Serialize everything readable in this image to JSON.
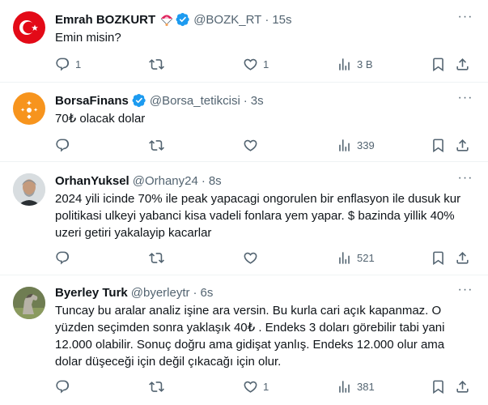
{
  "tweets": [
    {
      "name": "Emrah BOZKURT",
      "handle": "@BOZK_RT",
      "time": "15s",
      "text": "Emin misin?",
      "replies": "1",
      "retweets": "",
      "likes": "1",
      "views": "3 B",
      "icons": {
        "avatar": "turkish-flag-avatar",
        "emoji": "parachute-icon",
        "badge": "verified-icon"
      }
    },
    {
      "name": "BorsaFinans",
      "handle": "@Borsa_tetikcisi",
      "time": "3s",
      "text": "70₺ olacak dolar",
      "replies": "",
      "retweets": "",
      "likes": "",
      "views": "339",
      "icons": {
        "avatar": "orange-logo-avatar",
        "badge": "verified-icon"
      }
    },
    {
      "name": "OrhanYuksel",
      "handle": "@Orhany24",
      "time": "8s",
      "text": "2024 yili icinde 70% ile peak yapacagi ongorulen bir enflasyon ile dusuk kur politikasi ulkeyi yabanci kisa vadeli fonlara yem yapar. $ bazinda yillik 40% uzeri getiri yakalayip kacarlar",
      "replies": "",
      "retweets": "",
      "likes": "",
      "views": "521",
      "icons": {
        "avatar": "user-photo-avatar"
      }
    },
    {
      "name": "Byerley Turk",
      "handle": "@byerleytr",
      "time": "6s",
      "text": "Tuncay bu aralar analiz işine ara versin. Bu kurla cari açık kapanmaz. O yüzden seçimden sonra yaklaşık 40₺ . Endeks 3 doları görebilir tabi yani 12.000 olabilir. Sonuç doğru ama gidişat yanlış. Endeks 12.000 olur ama dolar düşeceği için değil çıkacağı için olur.",
      "replies": "",
      "retweets": "",
      "likes": "1",
      "views": "381",
      "icons": {
        "avatar": "horse-photo-avatar"
      }
    }
  ],
  "colors": {
    "text": "#0f1419",
    "secondary": "#536471",
    "verified": "#1d9bf0",
    "divider": "#eff3f4",
    "flag_red": "#e30a17",
    "borsa_orange": "#f7941d"
  }
}
